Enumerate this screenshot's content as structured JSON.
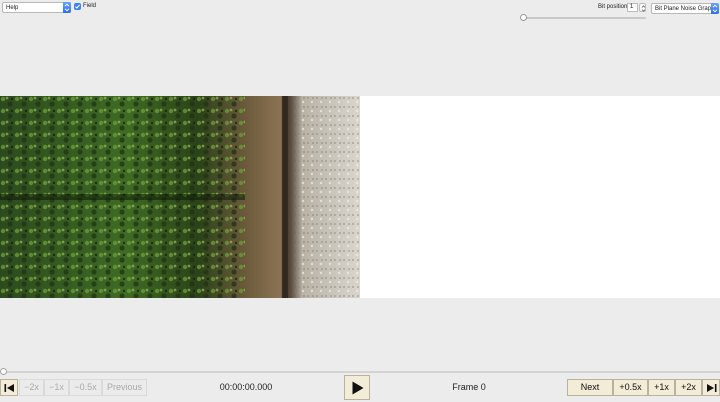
{
  "toolbar": {
    "help_select": "Help",
    "field_label": "Field",
    "field_checked": true,
    "bit_position_label": "Bit position",
    "bit_position_value": "1",
    "mode_select": "Bit Plane Noise Graph",
    "slider_value": 0
  },
  "player": {
    "timecode": "00:00:00.000",
    "frame": "Frame 0",
    "previous_label": "Previous",
    "next_label": "Next",
    "minus_2x": "−2x",
    "minus_1x": "−1x",
    "minus_half": "−0.5x",
    "plus_half": "+0.5x",
    "plus_1x": "+1x",
    "plus_2x": "+2x",
    "position": 0
  },
  "icons": {
    "play": "play-icon",
    "step_back": "step-back-icon",
    "step_forward": "step-forward-icon",
    "checkbox": "check-icon",
    "dropdown": "chevron-down-icon"
  },
  "colors": {
    "accent": "#3b82f6",
    "button_bg": "#f3ecd6",
    "disabled_text": "#a9a9a9"
  }
}
